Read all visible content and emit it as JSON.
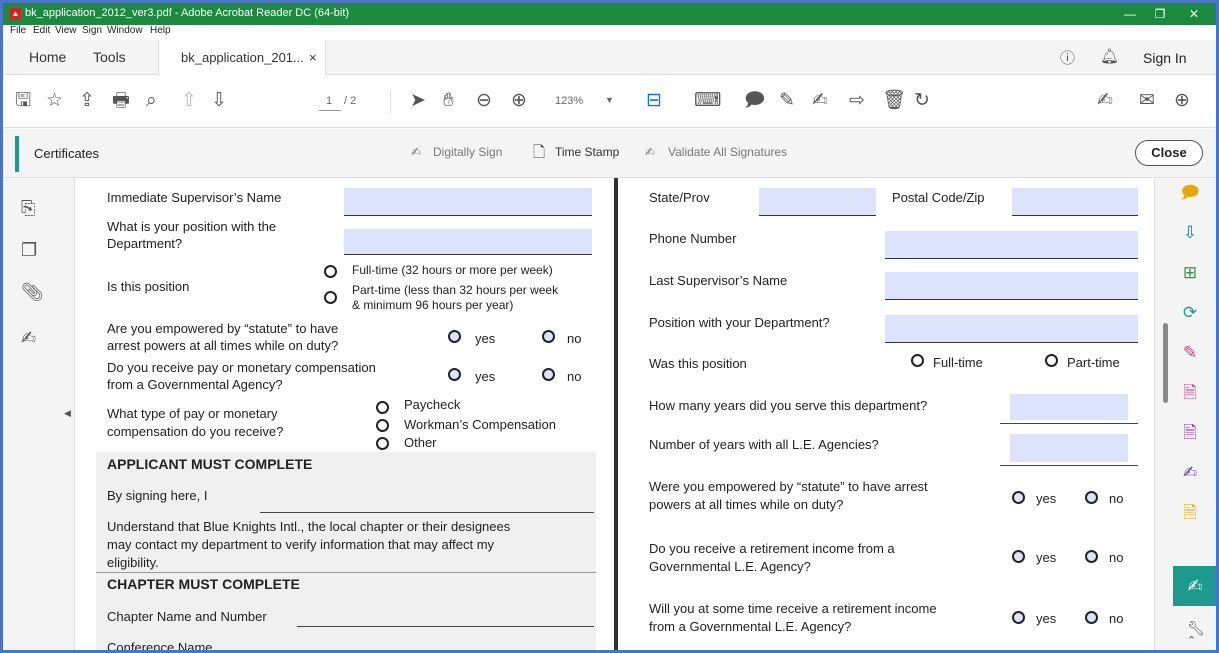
{
  "window": {
    "title": "bk_application_2012_ver3.pdf - Adobe Acrobat Reader DC (64-bit)",
    "minimize": "—",
    "restore": "❐",
    "close": "✕"
  },
  "menu": [
    "File",
    "Edit",
    "View",
    "Sign",
    "Window",
    "Help"
  ],
  "tabs": {
    "home": "Home",
    "tools": "Tools",
    "document": "bk_application_201...",
    "document_close": "×",
    "sign_in": "Sign In"
  },
  "toolbar": {
    "page_current": "1",
    "page_total": "/ 2",
    "zoom": "123%"
  },
  "certificates": {
    "label": "Certificates",
    "digitally_sign": "Digitally Sign",
    "time_stamp": "Time Stamp",
    "validate_all": "Validate All Signatures",
    "close": "Close"
  },
  "page1": {
    "supervisor_name": "Immediate Supervisor’s Name",
    "position_q1": "What is your position with the",
    "position_q2": "Department?",
    "is_position": "Is this position",
    "fulltime_opt": "Full-time (32 hours or more per week)",
    "parttime_opt1": "Part-time (less than 32 hours per week",
    "parttime_opt2": "& minimum 96 hours per year)",
    "empowered_q1": "Are you empowered by “statute” to have",
    "empowered_q2": "arrest powers at all times while on duty?",
    "pay_q1": "Do you receive pay or monetary compensation",
    "pay_q2": "from a Governmental Agency?",
    "yes": "yes",
    "no": "no",
    "paytype_q1": "What type of pay or monetary",
    "paytype_q2": "compensation do you receive?",
    "paycheck": "Paycheck",
    "workmans": "Workman’s Compensation",
    "other": "Other",
    "applicant_header": "APPLICANT MUST COMPLETE",
    "signing": "By signing here, I",
    "understand1": "Understand that Blue Knights Intl., the local chapter or their designees",
    "understand2": "may contact my department to verify information that may affect my",
    "understand3": "eligibility.",
    "chapter_header": "CHAPTER MUST COMPLETE",
    "chapter_name": "Chapter Name and Number",
    "conference_name": "Conference Name"
  },
  "page2": {
    "state": "State/Prov",
    "postal": "Postal Code/Zip",
    "phone": "Phone Number",
    "last_supervisor": "Last Supervisor’s Name",
    "position_dept": "Position with your Department?",
    "was_position": "Was this position",
    "fulltime": "Full-time",
    "parttime": "Part-time",
    "years_dept": "How many years did you serve this department?",
    "years_all": "Number of years with all L.E. Agencies?",
    "empowered1": "Were you empowered by “statute” to have arrest",
    "empowered2": "powers at all times while on duty?",
    "retire1": "Do you receive a retirement income from a",
    "retire2": "Governmental L.E. Agency?",
    "will_retire1": "Will you at some time receive a retirement income",
    "will_retire2": "from a Governmental L.E. Agency?",
    "yes": "yes",
    "no": "no"
  }
}
